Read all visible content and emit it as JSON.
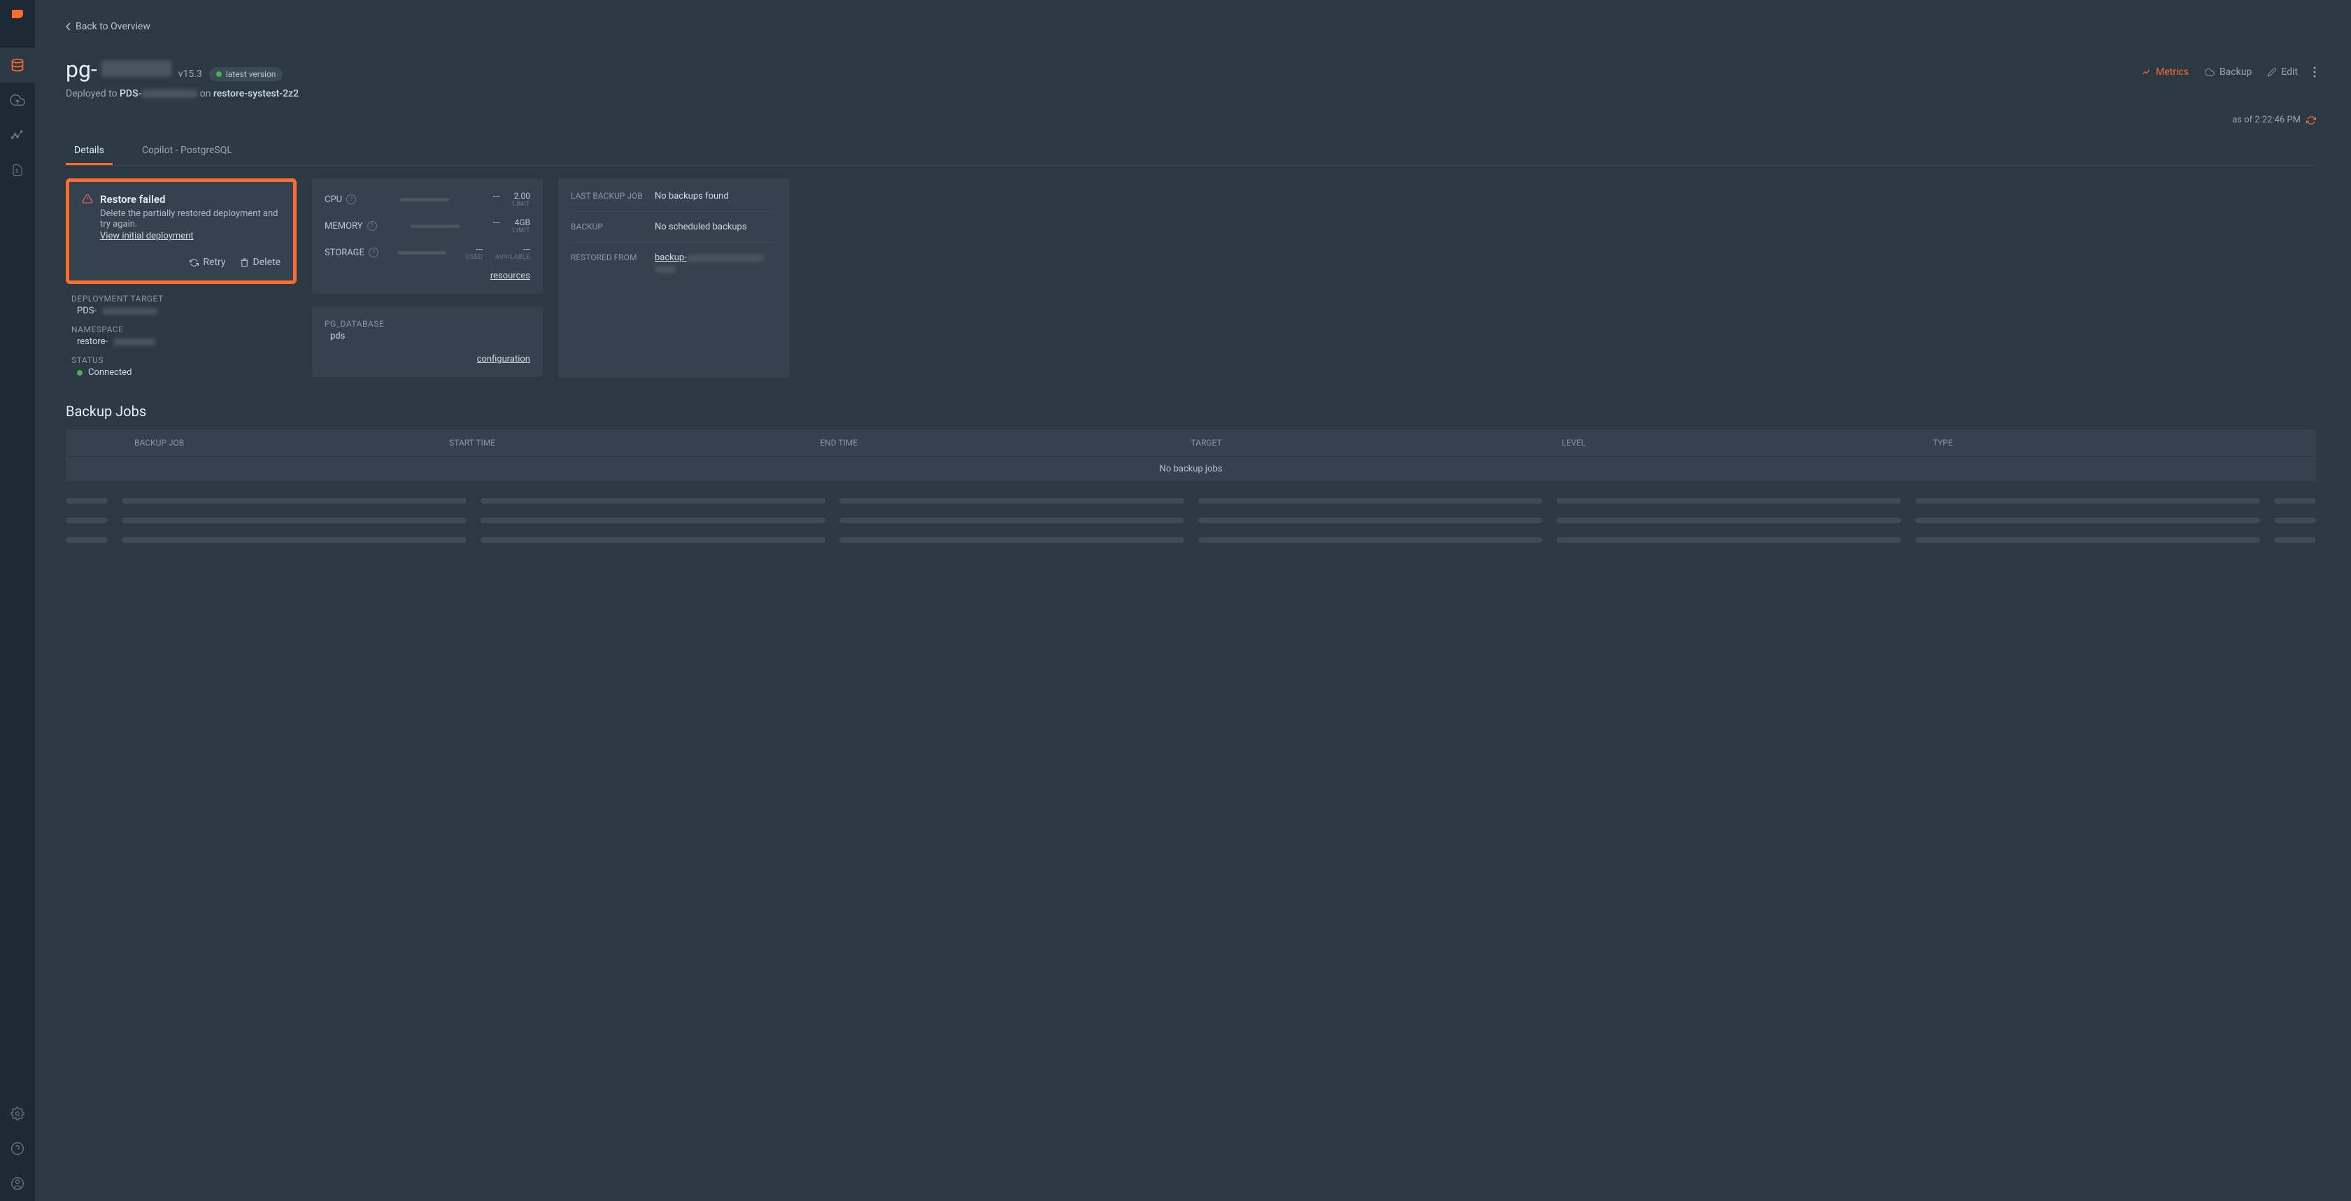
{
  "back_link": "Back to Overview",
  "title_prefix": "pg-",
  "version": "v15.3",
  "latest_badge": "latest version",
  "deployed_prefix": "Deployed to ",
  "deployed_pds_prefix": "PDS-",
  "deployed_on": " on ",
  "deployed_target": "restore-systest-2z2",
  "actions": {
    "metrics": "Metrics",
    "backup": "Backup",
    "edit": "Edit"
  },
  "updated_label": "as of 2:22:46 PM",
  "tabs": {
    "details": "Details",
    "copilot": "Copilot - PostgreSQL"
  },
  "alert": {
    "title": "Restore failed",
    "desc": "Delete the partially restored deployment and try again.",
    "link": "View initial deployment",
    "retry": "Retry",
    "delete": "Delete"
  },
  "meta": {
    "dep_target_label": "DEPLOYMENT TARGET",
    "dep_target_val": "PDS-",
    "ns_label": "NAMESPACE",
    "ns_val": "restore-",
    "status_label": "STATUS",
    "status_val": "Connected"
  },
  "resources": {
    "cpu_label": "CPU",
    "cpu_used": "---",
    "cpu_limit": "2.00",
    "mem_label": "MEMORY",
    "mem_used": "---",
    "mem_limit": "4GB",
    "sto_label": "STORAGE",
    "sto_used": "---",
    "sto_avail": "---",
    "limit_lbl": "LIMIT",
    "used_lbl": "USED",
    "avail_lbl": "AVAILABLE",
    "link": "resources"
  },
  "config": {
    "pgdb_label": "PG_DATABASE",
    "pgdb_val": "pds",
    "link": "configuration"
  },
  "backup_card": {
    "last_label": "LAST BACKUP JOB",
    "last_val": "No backups found",
    "sched_label": "BACKUP",
    "sched_val": "No scheduled backups",
    "restored_label": "RESTORED FROM",
    "restored_val": "backup-"
  },
  "jobs": {
    "title": "Backup Jobs",
    "cols": {
      "job": "BACKUP JOB",
      "start": "START TIME",
      "end": "END TIME",
      "target": "TARGET",
      "level": "LEVEL",
      "type": "TYPE"
    },
    "empty": "No backup jobs"
  }
}
